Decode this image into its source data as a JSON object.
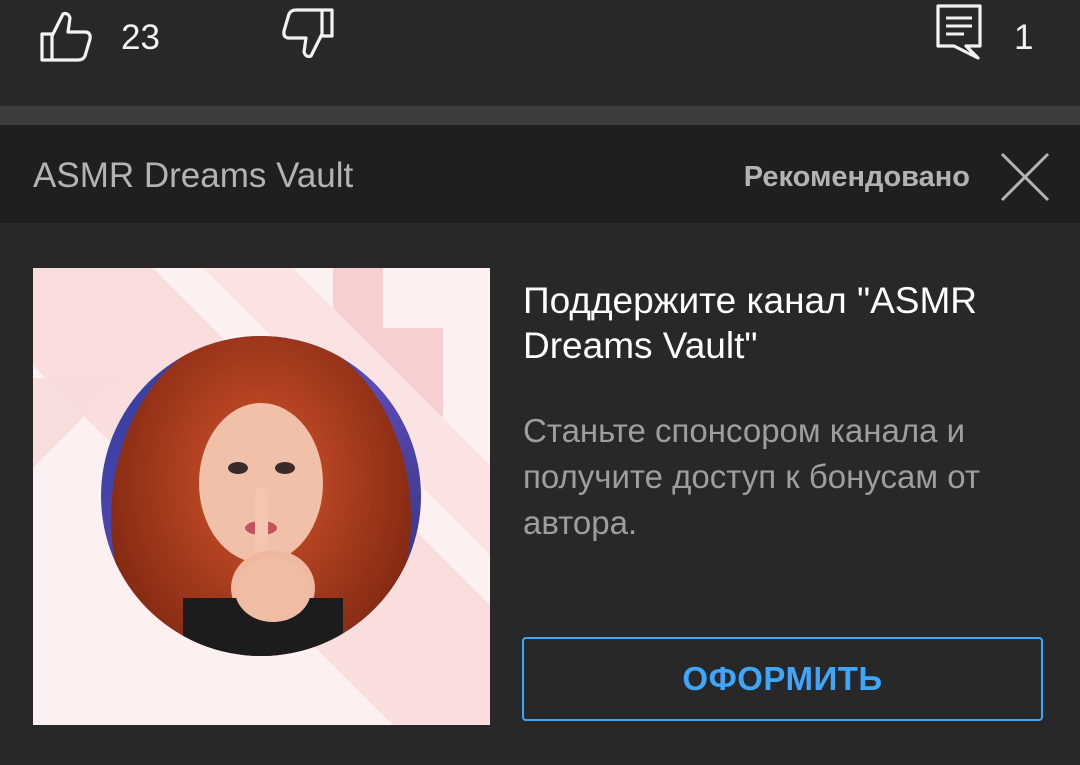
{
  "actions": {
    "like_count": "23",
    "comment_count": "1",
    "icons": [
      "thumbs-up-icon",
      "thumbs-down-icon",
      "comment-icon"
    ]
  },
  "card": {
    "channel_name": "ASMR Dreams Vault",
    "recommended_label": "Рекомендовано",
    "close_icon": "close-icon",
    "promo_title": "Поддержите канал \"ASMR Dreams Vault\"",
    "promo_description": "Станьте спонсором канала и получите доступ к бонусам от автора.",
    "button_label": "ОФОРМИТЬ"
  },
  "colors": {
    "accent": "#3ea6ff",
    "background": "#282828",
    "header_background": "#1f1f1f",
    "image_background": "#fdf0f0"
  }
}
